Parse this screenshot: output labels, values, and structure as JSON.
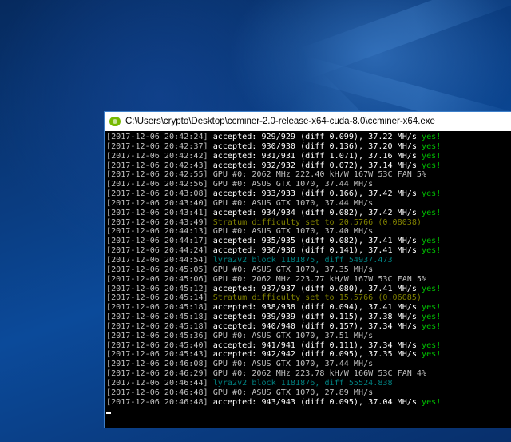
{
  "window": {
    "title": "C:\\Users\\crypto\\Desktop\\ccminer-2.0-release-x64-cuda-8.0\\ccminer-x64.exe",
    "icon": "nvidia-icon"
  },
  "colors": {
    "accepted": "#ffffff",
    "gpu": "#c0c0c0",
    "stratum": "#808000",
    "block": "#008080",
    "yes": "#00c000"
  },
  "yes_label": "yes!",
  "lines": [
    {
      "ts": "[2017-12-06 20:42:24]",
      "msg": "accepted: 929/929 (diff 0.099), 37.22 MH/s",
      "type": "accepted",
      "yes": true
    },
    {
      "ts": "[2017-12-06 20:42:37]",
      "msg": "accepted: 930/930 (diff 0.136), 37.20 MH/s",
      "type": "accepted",
      "yes": true
    },
    {
      "ts": "[2017-12-06 20:42:42]",
      "msg": "accepted: 931/931 (diff 1.071), 37.16 MH/s",
      "type": "accepted",
      "yes": true
    },
    {
      "ts": "[2017-12-06 20:42:43]",
      "msg": "accepted: 932/932 (diff 0.072), 37.14 MH/s",
      "type": "accepted",
      "yes": true
    },
    {
      "ts": "[2017-12-06 20:42:55]",
      "msg": "GPU #0: 2062 MHz 222.40 kH/W 167W 53C FAN 5%",
      "type": "gpu"
    },
    {
      "ts": "[2017-12-06 20:42:56]",
      "msg": "GPU #0: ASUS GTX 1070, 37.44 MH/s",
      "type": "gpu"
    },
    {
      "ts": "[2017-12-06 20:43:08]",
      "msg": "accepted: 933/933 (diff 0.166), 37.42 MH/s",
      "type": "accepted",
      "yes": true
    },
    {
      "ts": "[2017-12-06 20:43:40]",
      "msg": "GPU #0: ASUS GTX 1070, 37.44 MH/s",
      "type": "gpu"
    },
    {
      "ts": "[2017-12-06 20:43:41]",
      "msg": "accepted: 934/934 (diff 0.082), 37.42 MH/s",
      "type": "accepted",
      "yes": true
    },
    {
      "ts": "[2017-12-06 20:43:49]",
      "msg": "Stratum difficulty set to 20.5766 (0.08038)",
      "type": "stratum"
    },
    {
      "ts": "[2017-12-06 20:44:13]",
      "msg": "GPU #0: ASUS GTX 1070, 37.40 MH/s",
      "type": "gpu"
    },
    {
      "ts": "[2017-12-06 20:44:17]",
      "msg": "accepted: 935/935 (diff 0.082), 37.41 MH/s",
      "type": "accepted",
      "yes": true
    },
    {
      "ts": "[2017-12-06 20:44:24]",
      "msg": "accepted: 936/936 (diff 0.141), 37.41 MH/s",
      "type": "accepted",
      "yes": true
    },
    {
      "ts": "[2017-12-06 20:44:54]",
      "msg": "lyra2v2 block 1181875, diff 54937.473",
      "type": "block"
    },
    {
      "ts": "[2017-12-06 20:45:05]",
      "msg": "GPU #0: ASUS GTX 1070, 37.35 MH/s",
      "type": "gpu"
    },
    {
      "ts": "[2017-12-06 20:45:06]",
      "msg": "GPU #0: 2062 MHz 223.77 kH/W 167W 53C FAN 5%",
      "type": "gpu"
    },
    {
      "ts": "[2017-12-06 20:45:12]",
      "msg": "accepted: 937/937 (diff 0.080), 37.41 MH/s",
      "type": "accepted",
      "yes": true
    },
    {
      "ts": "[2017-12-06 20:45:14]",
      "msg": "Stratum difficulty set to 15.5766 (0.06085)",
      "type": "stratum"
    },
    {
      "ts": "[2017-12-06 20:45:18]",
      "msg": "accepted: 938/938 (diff 0.094), 37.41 MH/s",
      "type": "accepted",
      "yes": true
    },
    {
      "ts": "[2017-12-06 20:45:18]",
      "msg": "accepted: 939/939 (diff 0.115), 37.38 MH/s",
      "type": "accepted",
      "yes": true
    },
    {
      "ts": "[2017-12-06 20:45:18]",
      "msg": "accepted: 940/940 (diff 0.157), 37.34 MH/s",
      "type": "accepted",
      "yes": true
    },
    {
      "ts": "[2017-12-06 20:45:36]",
      "msg": "GPU #0: ASUS GTX 1070, 37.51 MH/s",
      "type": "gpu"
    },
    {
      "ts": "[2017-12-06 20:45:40]",
      "msg": "accepted: 941/941 (diff 0.111), 37.34 MH/s",
      "type": "accepted",
      "yes": true
    },
    {
      "ts": "[2017-12-06 20:45:43]",
      "msg": "accepted: 942/942 (diff 0.095), 37.35 MH/s",
      "type": "accepted",
      "yes": true
    },
    {
      "ts": "[2017-12-06 20:46:08]",
      "msg": "GPU #0: ASUS GTX 1070, 37.44 MH/s",
      "type": "gpu"
    },
    {
      "ts": "[2017-12-06 20:46:29]",
      "msg": "GPU #0: 2062 MHz 223.78 kH/W 166W 53C FAN 4%",
      "type": "gpu"
    },
    {
      "ts": "[2017-12-06 20:46:44]",
      "msg": "lyra2v2 block 1181876, diff 55524.838",
      "type": "block"
    },
    {
      "ts": "[2017-12-06 20:46:48]",
      "msg": "GPU #0: ASUS GTX 1070, 27.89 MH/s",
      "type": "gpu"
    },
    {
      "ts": "[2017-12-06 20:46:48]",
      "msg": "accepted: 943/943 (diff 0.095), 37.04 MH/s",
      "type": "accepted",
      "yes": true
    }
  ]
}
